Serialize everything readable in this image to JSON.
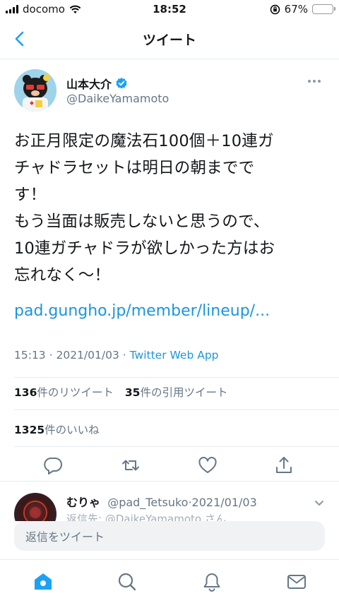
{
  "status_bar": {
    "carrier": "docomo",
    "time": "18:52",
    "battery_percent": "67%",
    "battery_level": 0.67
  },
  "nav": {
    "title": "ツイート",
    "back_icon": "chevron-left-icon"
  },
  "tweet": {
    "author_name": "山本大介",
    "author_handle": "@DaikeYamamoto",
    "verified": true,
    "text": "お正月限定の魔法石100個＋10連ガ\nチャドラセットは明日の朝までで\nす！\nもう当面は販売しないと思うので、\n10連ガチャドラが欲しかった方はお\n忘れなく〜！",
    "link": "pad.gungho.jp/member/lineup/...",
    "time": "15:13",
    "date": "2021/01/03",
    "separator": "·",
    "source": "Twitter Web App",
    "retweets_count": "136",
    "retweets_label": "件のリツイート",
    "quotes_count": "35",
    "quotes_label": "件の引用ツイート",
    "likes_count": "1325",
    "likes_label": "件のいいね"
  },
  "actions": {
    "reply_icon": "reply-icon",
    "retweet_icon": "retweet-icon",
    "like_icon": "heart-icon",
    "share_icon": "share-icon"
  },
  "reply_preview": {
    "name": "むりゃ",
    "handle": "@pad_Tetsuko",
    "separator": "·",
    "date": "2021/01/03",
    "sub": "返信先: @DaikeYamamoto さん"
  },
  "composer": {
    "placeholder": "返信をツイート"
  },
  "tab_bar": {
    "items": [
      "home-icon",
      "search-icon",
      "notifications-icon",
      "messages-icon"
    ]
  },
  "colors": {
    "accent": "#1da1f2",
    "link": "#1b95e0",
    "secondary_text": "#657786",
    "battery": "#4cd964"
  }
}
